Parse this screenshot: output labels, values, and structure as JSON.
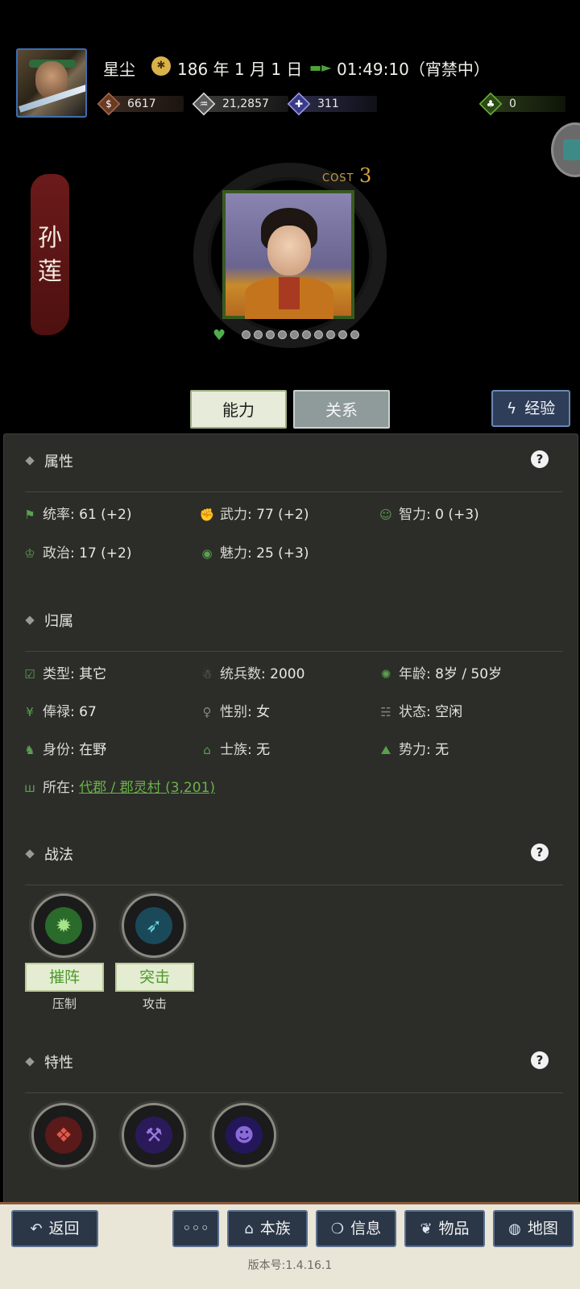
{
  "header": {
    "player_name": "星尘",
    "date": "186 年 1 月 1 日",
    "time": "01:49:10（宵禁中）",
    "resources": [
      {
        "name": "coin",
        "value": "6617",
        "color": "#8a4a2a"
      },
      {
        "name": "grain",
        "value": "21,2857",
        "color": "#9a9a9a"
      },
      {
        "name": "troops",
        "value": "311",
        "color": "#5a5aa8"
      },
      {
        "name": "gourd",
        "value": "0",
        "color": "#4e8a2a"
      }
    ]
  },
  "hero": {
    "name_line1": "孙",
    "name_line2": "莲",
    "cost_label": "COST",
    "cost_value": "3"
  },
  "tabs": {
    "ability": "能力",
    "relations": "关系",
    "experience": "经验"
  },
  "attributes": {
    "title": "属性",
    "items": [
      {
        "label": "统率",
        "value": "61 (+2)",
        "icon": "flag-icon"
      },
      {
        "label": "武力",
        "value": "77 (+2)",
        "icon": "fist-icon"
      },
      {
        "label": "智力",
        "value": "0 (+3)",
        "icon": "brain-icon"
      },
      {
        "label": "政治",
        "value": "17 (+2)",
        "icon": "crown-icon"
      },
      {
        "label": "魅力",
        "value": "25 (+3)",
        "icon": "eye-icon"
      }
    ]
  },
  "affiliation": {
    "title": "归属",
    "items": [
      {
        "label": "类型",
        "value": "其它",
        "icon": "calendar-icon"
      },
      {
        "label": "统兵数",
        "value": "2000",
        "icon": "person-icon"
      },
      {
        "label": "年龄",
        "value": "8岁 / 50岁",
        "icon": "age-icon"
      },
      {
        "label": "俸禄",
        "value": "67",
        "icon": "yen-icon"
      },
      {
        "label": "性别",
        "value": "女",
        "icon": "gender-icon"
      },
      {
        "label": "状态",
        "value": "空闲",
        "icon": "status-icon"
      },
      {
        "label": "身份",
        "value": "在野",
        "icon": "identity-icon"
      },
      {
        "label": "士族",
        "value": "无",
        "icon": "clan-icon"
      },
      {
        "label": "势力",
        "value": "无",
        "icon": "faction-icon"
      }
    ],
    "location_label": "所在",
    "location_value": "代郡 / 郡灵村 (3,201)"
  },
  "tactics": {
    "title": "战法",
    "items": [
      {
        "tag": "摧阵",
        "sub": "压制",
        "color": "#3aa04a"
      },
      {
        "tag": "突击",
        "sub": "攻击",
        "color": "#2a9aa8"
      }
    ]
  },
  "traits": {
    "title": "特性",
    "items": [
      {
        "color": "#b0302a"
      },
      {
        "color": "#5a3ab0"
      },
      {
        "color": "#4a2a9a"
      }
    ]
  },
  "help_mark": "?",
  "bottom_nav": {
    "back": "返回",
    "more": "◦◦◦",
    "clan": "本族",
    "info": "信息",
    "items": "物品",
    "map": "地图"
  },
  "version": "版本号:1.4.16.1"
}
